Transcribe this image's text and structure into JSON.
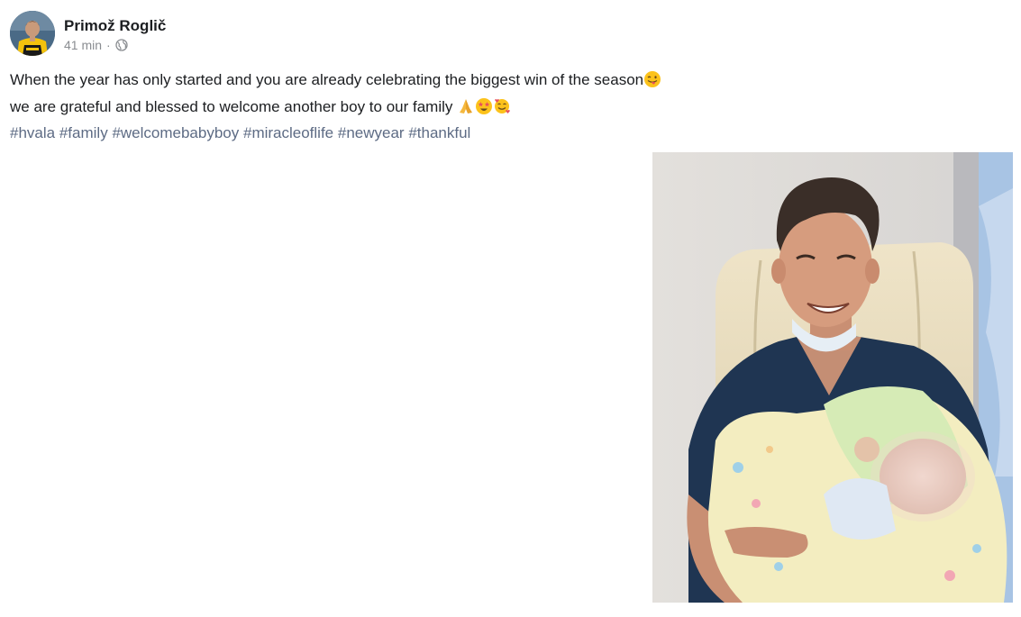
{
  "post": {
    "author": "Primož Roglič",
    "timestamp": "41 min",
    "separator": "·",
    "audience_icon": "globe-icon",
    "line1": "When the year has only started and you are already celebrating the biggest win of the season",
    "line2": "we are grateful and blessed to welcome another boy to our family",
    "line1_emojis": [
      "winking-face-with-tongue"
    ],
    "line2_emojis": [
      "folded-hands",
      "star-struck",
      "smiling-face-with-hearts"
    ],
    "hashtags": [
      "#hvala",
      "#family",
      "#welcomebabyboy",
      "#miracleoflife",
      "#newyear",
      "#thankful"
    ]
  },
  "colors": {
    "text": "#1c1e21",
    "meta": "#8a8d91",
    "hashtag": "#5d6b84",
    "jersey_yellow": "#f4c20d"
  }
}
